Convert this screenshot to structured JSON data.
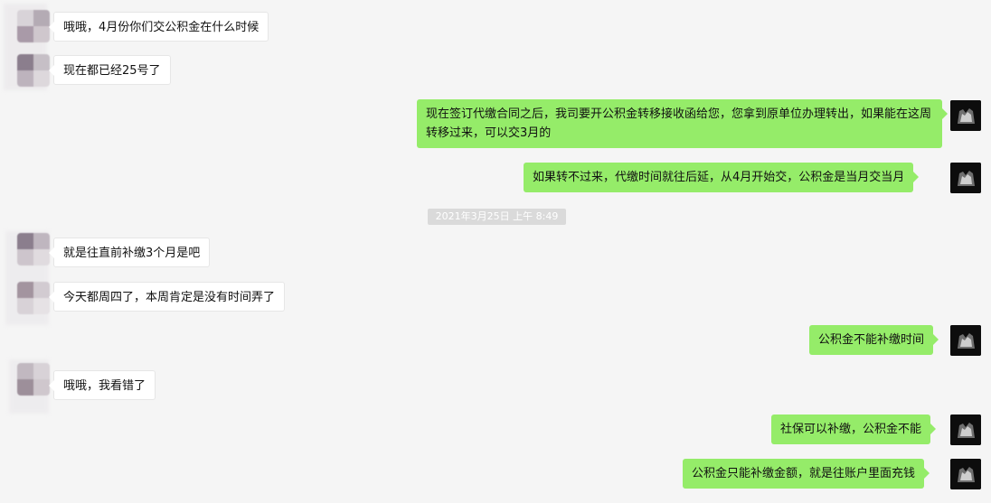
{
  "messages": [
    {
      "side": "left",
      "text": "哦哦，4月份你们交公积金在什么时候"
    },
    {
      "side": "left",
      "text": "现在都已经25号了"
    },
    {
      "side": "right",
      "text": "现在签订代缴合同之后，我司要开公积金转移接收函给您，您拿到原单位办理转出，如果能在这周转移过来，可以交3月的"
    },
    {
      "side": "right",
      "text": "如果转不过来，代缴时间就往后延，从4月开始交，公积金是当月交当月"
    },
    {
      "side": "left",
      "text": "就是往直前补缴3个月是吧"
    },
    {
      "side": "left",
      "text": "今天都周四了，本周肯定是没有时间弄了"
    },
    {
      "side": "right",
      "text": "公积金不能补缴时间"
    },
    {
      "side": "left",
      "text": "哦哦，我看错了"
    },
    {
      "side": "right",
      "text": "社保可以补缴，公积金不能"
    },
    {
      "side": "right",
      "text": "公积金只能补缴金额，就是往账户里面充钱"
    }
  ],
  "timestamp": "2021年3月25日 上午 8:49",
  "colors": {
    "background": "#f5f5f5",
    "sent_bubble": "#95ec69",
    "received_bubble": "#ffffff",
    "timestamp_bg": "#dadada"
  },
  "icons": {
    "contact_avatar": "blurred-avatar-icon",
    "own_avatar": "dark-photo-avatar-icon"
  }
}
